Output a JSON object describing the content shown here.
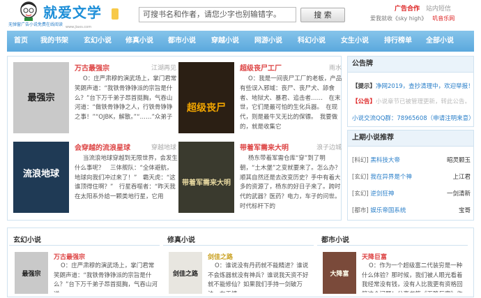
{
  "header": {
    "site_name": "就爱文学",
    "slogan": "无弹窗广告小说免费在线阅读",
    "domain": "www.jiaxs.com",
    "search_placeholder": "可搜书名和作者，请您少字也别输错字。",
    "search_button": "搜 索",
    "ad_link": "广告合作",
    "sms_link": "站内短信",
    "fav_text": "爱我就收《sky high》",
    "fav_link": "叽音乐网"
  },
  "nav": [
    "首页",
    "我的书架",
    "玄幻小说",
    "修真小说",
    "都市小说",
    "穿越小说",
    "网游小说",
    "科幻小说",
    "女生小说",
    "排行榜单",
    "全部小说"
  ],
  "featured": [
    {
      "title": "万古最强宗",
      "author": "江湖再见",
      "desc": "O：庄严肃穆的演武场上，掌门君常笑朗声道：“我铁骨铮铮派的宗旨是什么？”台下万千弟子昂首挺胸，气吞山河道：“做铁骨铮铮之人，行铁骨铮铮之事！”“OJBK，解散。”“……”众弟子",
      "cover": "最强宗",
      "cover_bg": "#c9c9c9",
      "cover_fg": "#222"
    },
    {
      "title": "超级丧尸工厂",
      "author": "雨水",
      "desc": "O：我是一间丧尸工厂的老板，产品有些误入邪域：丧尸、丧尸犬、舔食者、地狱犬、暴君、追击者……　在末世，它们是最可怕的生化兵器。　在现代，则是最牛叉无比的保镖。　我要做的，就是收集它",
      "cover": "超级丧尸",
      "cover_bg": "#2b1f14",
      "cover_fg": "#f2a500"
    },
    {
      "title": "会穿越的流浪星球",
      "author": "穿越地球",
      "desc": "当流浪地球穿越到无限世界，会发生什么事呢？　三体舰队：“全体避航，地球向我们冲过来了！”　霸天虎：“这谁顶得住啊？”　行星吞噬者：“昨天我在太阳系外给一颗类地行星，它用",
      "cover": "流浪地球",
      "cover_bg": "#1f3a55",
      "cover_fg": "#ffffff"
    },
    {
      "title": "带着军需来大明",
      "author": "浪子边城",
      "desc": "杨东带着军需仓库“穿”到了明朝，“土木堡”之变就要来了。怎么办？顺其自然还是去改变历史？手中有着大多的资源了，杨东的好日子来了。跨时代的武器？医药？电力，车子的问世。时代标杆下的",
      "cover": "带着军需来大明",
      "cover_bg": "#3a3a2e",
      "cover_fg": "#e8d9a0"
    }
  ],
  "notice": {
    "heading": "公告牌",
    "line1_tag": "【提示】",
    "line1_text": "净网2019，查抄清理中，欢迎举报！",
    "line2_tag": "【公告】",
    "line2_text": "小说章节已被管理更新，转此公告。",
    "line3_text": "小说交流QQ群：78965608（申请注明来意）"
  },
  "recommend": {
    "heading": "上期小说推荐",
    "rows": [
      {
        "cat": "[科幻]",
        "book": "黑科技大帝",
        "author": "昭灵颢玉"
      },
      {
        "cat": "[玄幻]",
        "book": "我在异界是个神",
        "author": "上江君"
      },
      {
        "cat": "[玄幻]",
        "book": "逆剑狂神",
        "author": "一剑清新"
      },
      {
        "cat": "[都市]",
        "book": "娱乐帝国系统",
        "author": "宝哥"
      }
    ]
  },
  "sections": [
    {
      "heading": "玄幻小说",
      "book": "万古最强宗",
      "color": "#d44",
      "desc": "O：庄严肃穆的演武场上，掌门君常笑朗声道：“我铁骨铮铮派的宗旨是什么？”台下万千弟子昂首挺胸，气吞山河道",
      "cover": "最强宗",
      "cover_bg": "#c9c9c9",
      "cover_fg": "#222"
    },
    {
      "heading": "修真小说",
      "book": "剑佳之路",
      "color": "#c9a020",
      "desc": "O：谁说没有丹药就不能精进？谁说不会炼器就没有神兵？谁说我天资不好就不能修仙？如果我们手持一剑破万法，在于情",
      "cover": "剑佳之路",
      "cover_bg": "#e8e6e0",
      "cover_fg": "#222"
    },
    {
      "heading": "都市小说",
      "book": "天降巨富",
      "color": "#d44",
      "desc": "O：作为一个超级富二代装穷是一种什么体验？那时候，我们被人眼光看着我经常没有钱，没有人比我更有资格回答这个问题！分享书籍《天降巨富》作者",
      "cover": "大降富",
      "cover_bg": "#7a4a3a",
      "cover_fg": "#ffe"
    }
  ]
}
